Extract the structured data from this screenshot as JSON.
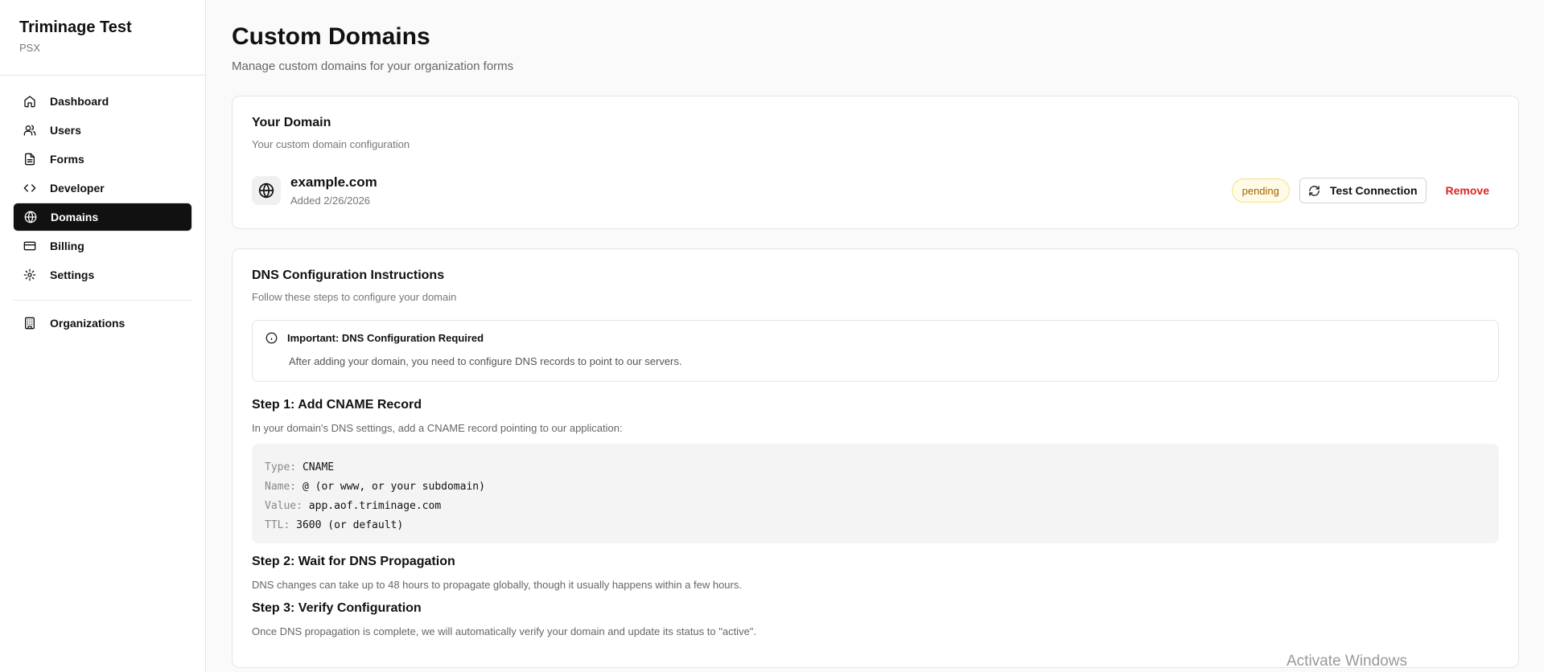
{
  "sidebar": {
    "org_name": "Triminage Test",
    "org_sub": "PSX",
    "items": [
      {
        "label": "Dashboard",
        "icon": "home-icon"
      },
      {
        "label": "Users",
        "icon": "users-icon"
      },
      {
        "label": "Forms",
        "icon": "file-icon"
      },
      {
        "label": "Developer",
        "icon": "code-icon"
      },
      {
        "label": "Domains",
        "icon": "globe-icon",
        "active": true
      },
      {
        "label": "Billing",
        "icon": "credit-card-icon"
      },
      {
        "label": "Settings",
        "icon": "gear-icon"
      }
    ],
    "secondary": [
      {
        "label": "Organizations",
        "icon": "building-icon"
      }
    ]
  },
  "header": {
    "title": "Custom Domains",
    "subtitle": "Manage custom domains for your organization forms"
  },
  "domain_card": {
    "title": "Your Domain",
    "subtitle": "Your custom domain configuration",
    "domain": "example.com",
    "added": "Added 2/26/2026",
    "status": "pending",
    "test_label": "Test Connection",
    "remove_label": "Remove"
  },
  "dns_card": {
    "title": "DNS Configuration Instructions",
    "subtitle": "Follow these steps to configure your domain",
    "alert_title": "Important: DNS Configuration Required",
    "alert_body": "After adding your domain, you need to configure DNS records to point to our servers.",
    "step1_title": "Step 1: Add CNAME Record",
    "step1_text": "In your domain's DNS settings, add a CNAME record pointing to our application:",
    "record": {
      "type_key": "Type:",
      "type_val": "CNAME",
      "name_key": "Name:",
      "name_val": "@ (or www, or your subdomain)",
      "value_key": "Value:",
      "value_val": "app.aof.triminage.com",
      "ttl_key": "TTL:",
      "ttl_val": "3600 (or default)"
    },
    "step2_title": "Step 2: Wait for DNS Propagation",
    "step2_text": "DNS changes can take up to 48 hours to propagate globally, though it usually happens within a few hours.",
    "step3_title": "Step 3: Verify Configuration",
    "step3_text": "Once DNS propagation is complete, we will automatically verify your domain and update its status to \"active\"."
  },
  "watermark": "Activate Windows",
  "colors": {
    "active_nav_bg": "#111111",
    "pending_badge": "#a16207",
    "remove": "#dc2626"
  }
}
